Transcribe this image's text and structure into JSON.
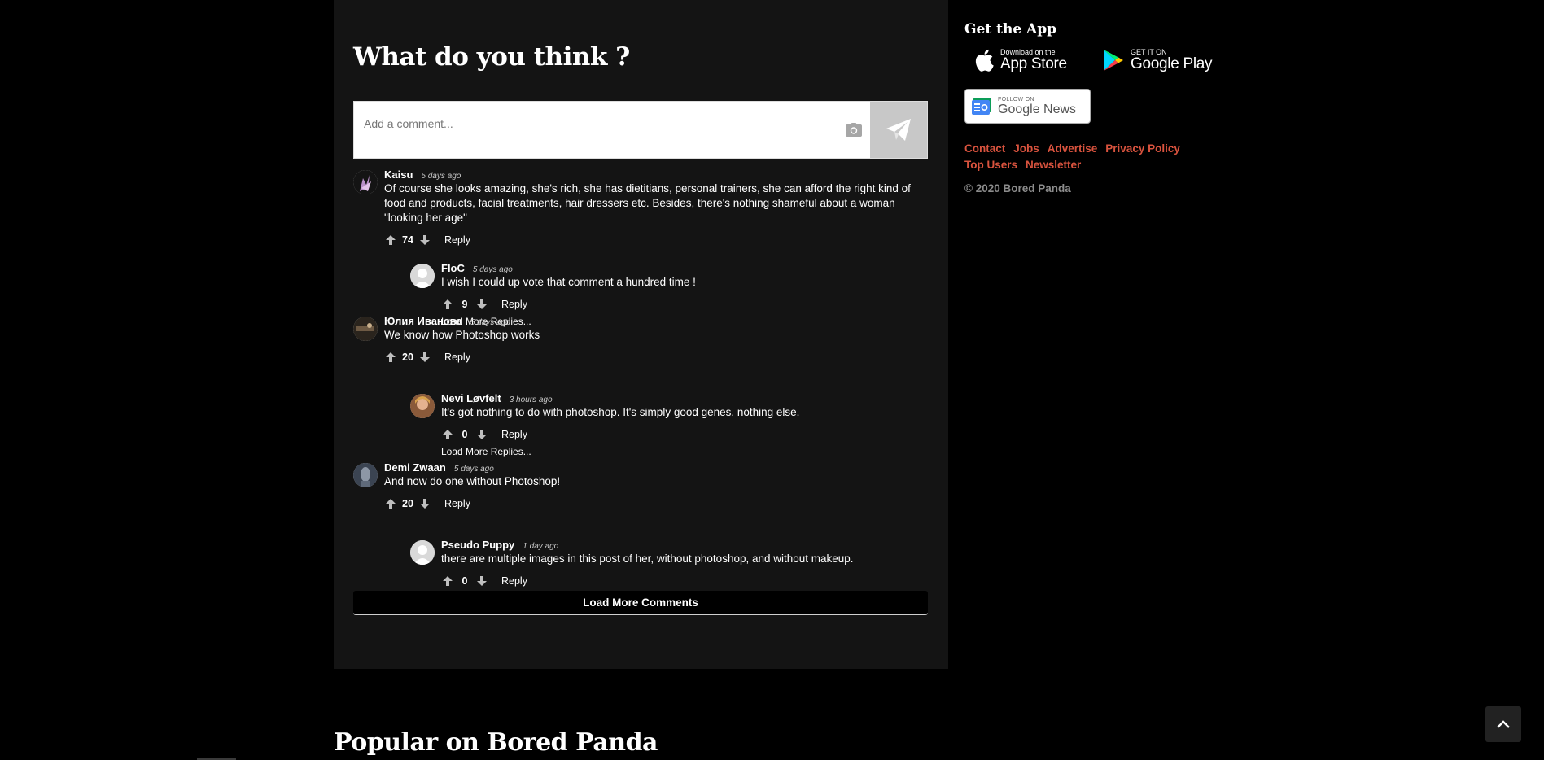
{
  "comments_section": {
    "title": "What do you think ?",
    "input_placeholder": "Add a comment...",
    "load_more_label": "Load More Comments",
    "reply_label": "Reply",
    "load_more_replies_label": "Load More Replies...",
    "threads": [
      {
        "author": "Kaisu",
        "time": "5 days ago",
        "text": "Of course she looks amazing, she's rich, she has dietitians, personal trainers, she can afford the right kind of food and products, facial treatments, hair dressers etc. Besides, there's nothing shameful about a woman \"looking her age\"",
        "votes": "74",
        "reply": {
          "author": "FloC",
          "time": "5 days ago",
          "text": "I wish I could up vote that comment a hundred time !",
          "votes": "9",
          "has_more": true
        }
      },
      {
        "author": "Юлия Иванова",
        "time": "5 days ago",
        "text": "We know how Photoshop works",
        "votes": "20",
        "reply": {
          "author": "Nevi Løvfelt",
          "time": "3 hours ago",
          "text": "It's got nothing to do with photoshop. It's simply good genes, nothing else.",
          "votes": "0",
          "has_more": true
        }
      },
      {
        "author": "Demi Zwaan",
        "time": "5 days ago",
        "text": "And now do one without Photoshop!",
        "votes": "20",
        "reply": {
          "author": "Pseudo Puppy",
          "time": "1 day ago",
          "text": "there are multiple images in this post of her, without photoshop, and without makeup.",
          "votes": "0",
          "has_more": false
        }
      }
    ]
  },
  "sidebar": {
    "get_app_title": "Get the App",
    "app_store": {
      "small": "Download on the",
      "big": "App Store"
    },
    "google_play": {
      "small": "GET IT ON",
      "big": "Google Play"
    },
    "google_news": {
      "small": "FOLLOW ON",
      "big": "Google News"
    },
    "footer_links": [
      "Contact",
      "Jobs",
      "Advertise",
      "Privacy Policy",
      "Top Users",
      "Newsletter"
    ],
    "copyright": "© 2020 Bored Panda"
  },
  "popular_title": "Popular on Bored Panda",
  "colors": {
    "link_accent": "#d9533e",
    "panel_bg": "#141414",
    "page_bg": "#000000"
  },
  "icons": [
    "camera-icon",
    "send-icon",
    "upvote-icon",
    "downvote-icon",
    "apple-icon",
    "google-play-icon",
    "google-news-icon",
    "chevron-up-icon"
  ]
}
